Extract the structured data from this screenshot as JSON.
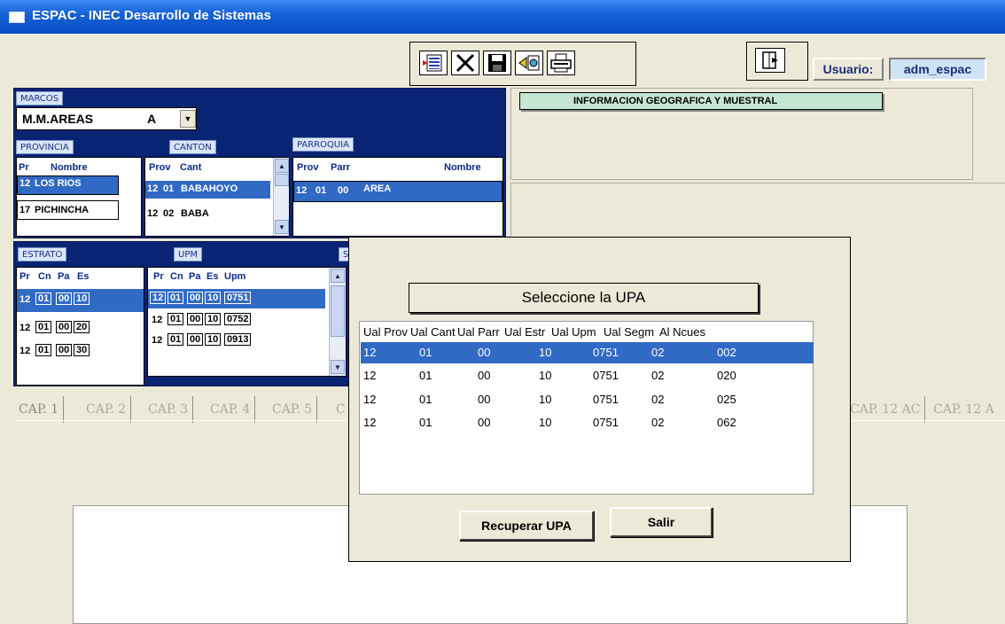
{
  "window": {
    "title": "ESPAC -  INEC Desarrollo de Sistemas"
  },
  "toolbar": {
    "buttons": [
      "new-record-icon",
      "delete-icon",
      "save-icon",
      "recover-icon",
      "print-icon",
      "exit-icon"
    ],
    "usuario_label": "Usuario:",
    "usuario_value": "adm_espac"
  },
  "marcos": {
    "label": "MARCOS",
    "selected": "M.M.AREAS",
    "code": "A"
  },
  "provincia": {
    "label": "PROVINCIA",
    "headers": [
      "Pr",
      "Nombre"
    ],
    "rows": [
      [
        "12",
        "LOS RIOS"
      ],
      [
        "17",
        "PICHINCHA"
      ]
    ]
  },
  "canton": {
    "label": "CANTON",
    "headers": [
      "Prov",
      "Cant"
    ],
    "rows": [
      [
        "12",
        "01",
        "BABAHOYO"
      ],
      [
        "12",
        "02",
        "BABA"
      ]
    ]
  },
  "parroquia": {
    "label": "PARROQUIA",
    "headers": [
      "Prov",
      "Parr",
      "Nombre"
    ],
    "rows": [
      [
        "12",
        "01",
        "00",
        "AREA"
      ]
    ]
  },
  "estrato": {
    "label": "ESTRATO",
    "headers": [
      "Pr",
      "Cn",
      "Pa",
      "Es"
    ],
    "rows": [
      [
        "12",
        "01",
        "00",
        "10"
      ],
      [
        "12",
        "01",
        "00",
        "20"
      ],
      [
        "12",
        "01",
        "00",
        "30"
      ]
    ]
  },
  "upm": {
    "label": "UPM",
    "headers": [
      "Pr",
      "Cn",
      "Pa",
      "Es",
      "Upm"
    ],
    "rows": [
      [
        "12",
        "01",
        "00",
        "10",
        "0751"
      ],
      [
        "12",
        "01",
        "00",
        "10",
        "0752"
      ],
      [
        "12",
        "01",
        "00",
        "10",
        "0913"
      ]
    ]
  },
  "segm_label_partial": "S",
  "geo": {
    "header": "INFORMACION GEOGRAFICA Y MUESTRAL"
  },
  "cap_tabs": [
    "CAP. 1",
    "CAP. 2",
    "CAP. 3",
    "CAP. 4",
    "CAP. 5",
    "C"
  ],
  "cap_tabs_right": [
    "CAP. 12 AC",
    "CAP. 12 A"
  ],
  "modal": {
    "title": "Seleccione la UPA",
    "headers": [
      "Ual Prov",
      "Ual Cant",
      "Ual Parr",
      "Ual Estr",
      "Ual Upm",
      "Ual Segm",
      "Al Ncues"
    ],
    "rows": [
      [
        "12",
        "01",
        "00",
        "10",
        "0751",
        "02",
        "002"
      ],
      [
        "12",
        "01",
        "00",
        "10",
        "0751",
        "02",
        "020"
      ],
      [
        "12",
        "01",
        "00",
        "10",
        "0751",
        "02",
        "025"
      ],
      [
        "12",
        "01",
        "00",
        "10",
        "0751",
        "02",
        "062"
      ]
    ],
    "recuperar_label": "Recuperar UPA",
    "salir_label": "Salir"
  }
}
